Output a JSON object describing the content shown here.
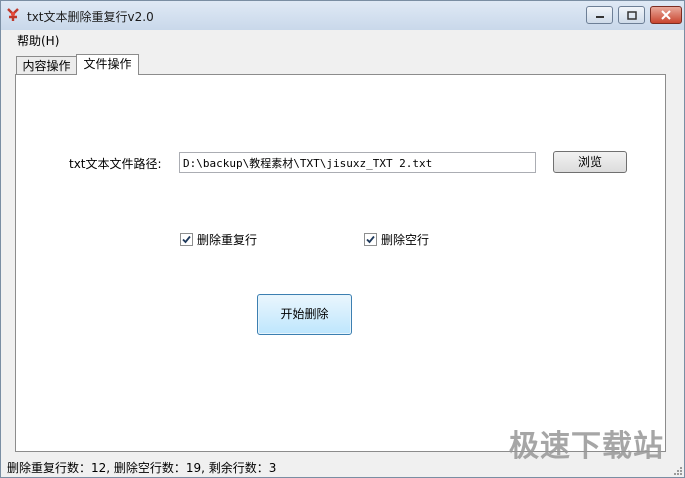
{
  "window": {
    "title": "txt文本删除重复行v2.0",
    "minimize_icon": "minimize-icon",
    "maximize_icon": "maximize-icon",
    "close_icon": "close-icon"
  },
  "menu": {
    "help_label": "帮助(H)"
  },
  "tabs": [
    {
      "label": "内容操作",
      "active": false
    },
    {
      "label": "文件操作",
      "active": true
    }
  ],
  "form": {
    "path_label": "txt文本文件路径:",
    "path_value": "D:\\backup\\教程素材\\TXT\\jisuxz_TXT 2.txt",
    "browse_label": "浏览",
    "delete_duplicate_label": "删除重复行",
    "delete_duplicate_checked": true,
    "delete_empty_label": "删除空行",
    "delete_empty_checked": true,
    "start_label": "开始删除"
  },
  "status": {
    "text": "删除重复行数：12, 删除空行数：19, 剩余行数：3"
  },
  "watermark": "极速下载站",
  "colors": {
    "titlebar": "#c9d8ea",
    "close": "#c9452f",
    "start_button": "#bee6fd"
  }
}
